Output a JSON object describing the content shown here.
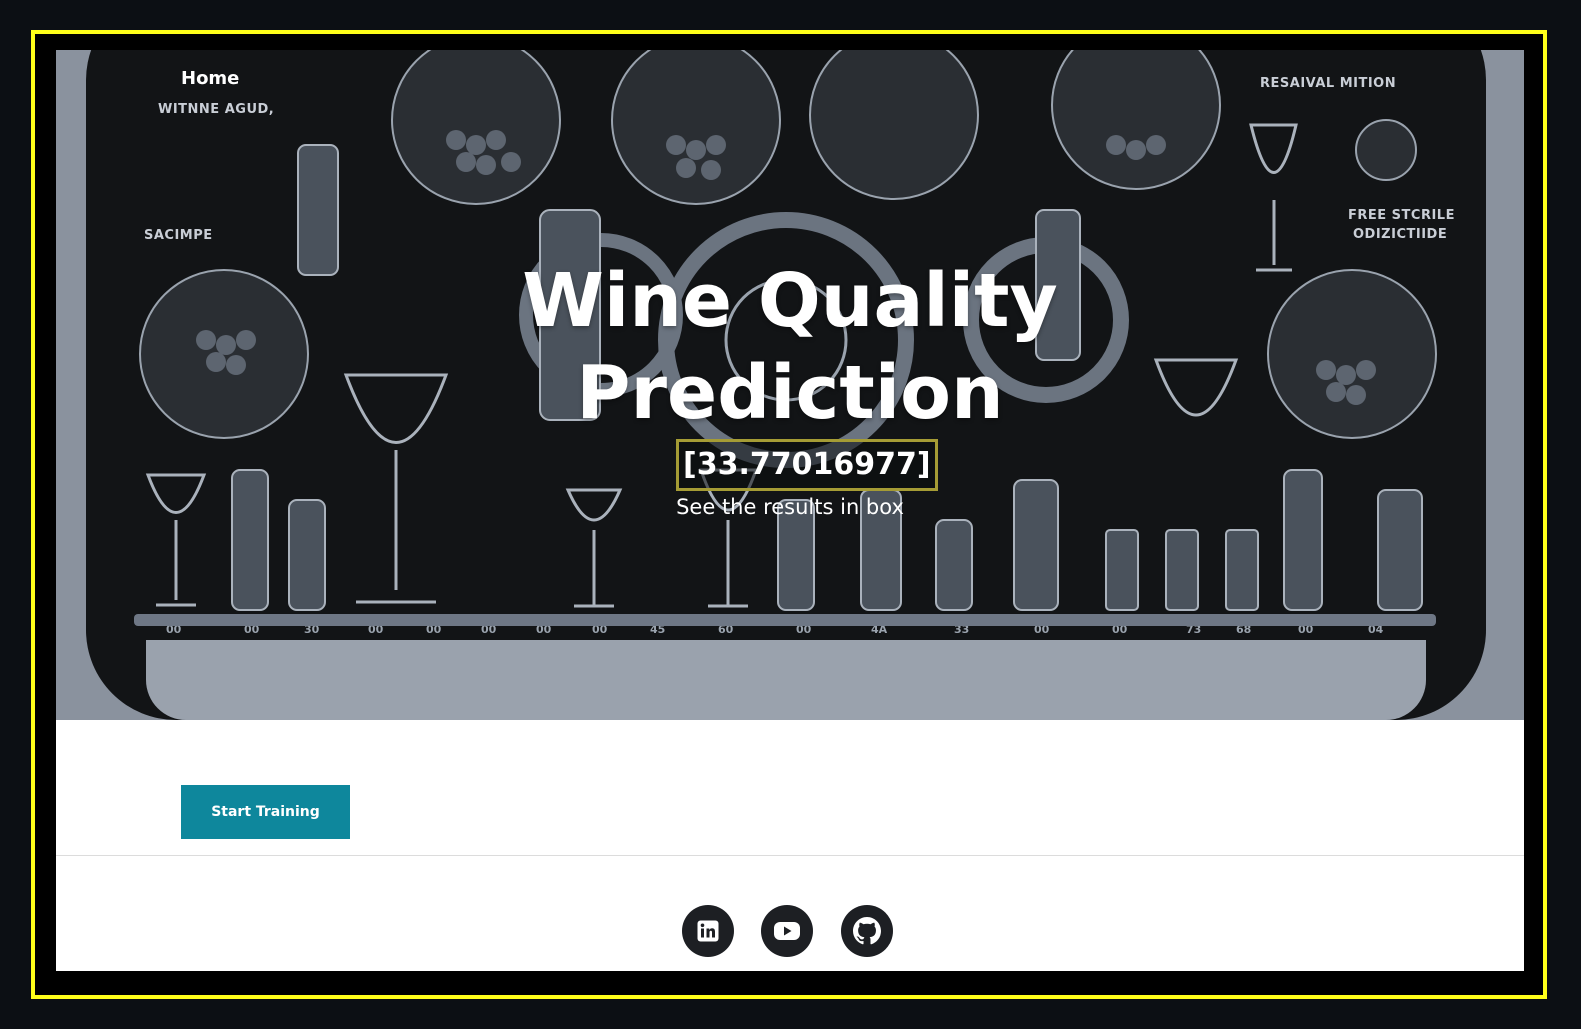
{
  "nav": {
    "home_label": "Home"
  },
  "hero": {
    "title_line1": "Wine Quality",
    "title_line2": "Prediction",
    "result_value": "[33.77016977]",
    "subtitle": "See the results in box"
  },
  "actions": {
    "start_training_label": "Start Training"
  },
  "footer": {
    "social": [
      {
        "name": "linkedin-icon"
      },
      {
        "name": "youtube-icon"
      },
      {
        "name": "github-icon"
      }
    ]
  },
  "colors": {
    "frame_border": "#ffff1a",
    "button_bg": "#0e879c",
    "result_border": "#a59c35"
  }
}
